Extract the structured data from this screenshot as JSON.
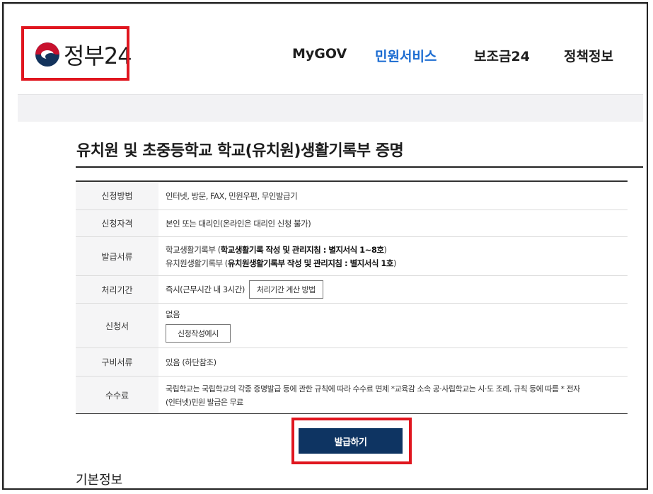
{
  "header": {
    "logo_text": "정부24",
    "nav": [
      "MyGOV",
      "민원서비스",
      "보조금24",
      "정책정보"
    ],
    "active_nav": "민원서비스"
  },
  "page": {
    "title": "유치원 및 초중등학교 학교(유치원)생활기록부 증명"
  },
  "info_rows": [
    {
      "label": "신청방법",
      "value": "인터넷, 방문, FAX, 민원우편, 무인발급기"
    },
    {
      "label": "신청자격",
      "value": "본인 또는 대리인(온라인은 대리인 신청 불가)"
    },
    {
      "label": "발급서류",
      "line1_prefix": "학교생활기록부 (",
      "line1_bold": "학교생활기록 작성 및 관리지침 : 별지서식 1~8호",
      "line1_suffix": ")",
      "line2_prefix": "유치원생활기록부 (",
      "line2_bold": "유치원생활기록부 작성 및 관리지침 : 별지서식 1호",
      "line2_suffix": ")"
    },
    {
      "label": "처리기간",
      "value": "즉시(근무시간 내 3시간)",
      "button": "처리기간 계산 방법"
    },
    {
      "label": "신청서",
      "value": "없음",
      "button": "신청작성예시"
    },
    {
      "label": "구비서류",
      "value": "있음 (하단참조)"
    },
    {
      "label": "수수료",
      "line1": "국립학교는 국립학교의 각종 증명발급 등에 관한 규칙에 따라 수수료 면제 *교육감 소속 공·사립학교는 시·도 조례, 규칙 등에 따름 * 전자",
      "line2": "(인터넷)민원 발급은 무료"
    }
  ],
  "issue_button": "발급하기",
  "section_title": "기본정보",
  "colors": {
    "brand_navy": "#0e3462",
    "accent_blue": "#1a6bd1",
    "highlight_red": "#e0161f"
  }
}
